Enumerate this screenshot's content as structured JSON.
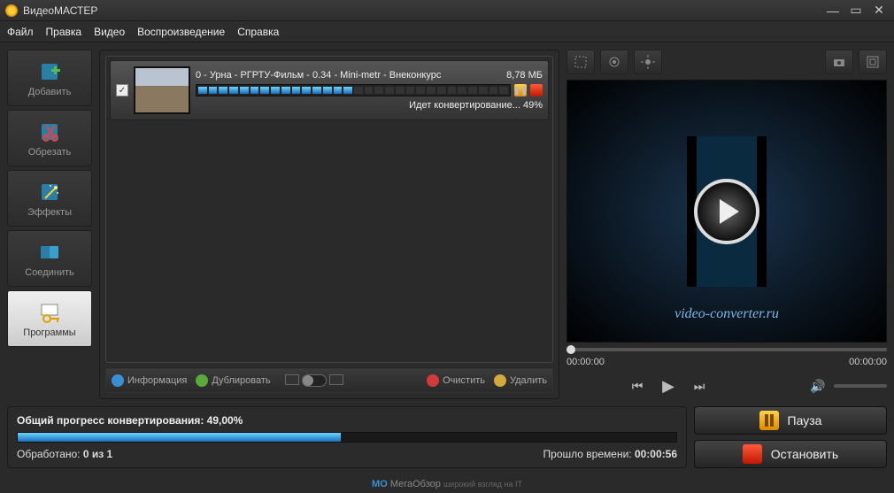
{
  "app": {
    "title": "ВидеоМАСТЕР"
  },
  "menu": {
    "file": "Файл",
    "edit": "Правка",
    "video": "Видео",
    "playback": "Воспроизведение",
    "help": "Справка"
  },
  "sidebar": {
    "add": "Добавить",
    "cut": "Обрезать",
    "effects": "Эффекты",
    "join": "Соединить",
    "programs": "Программы"
  },
  "item": {
    "name": "0 - Урна - РГРТУ-Фильм - 0.34 - Mini-metr - Внеконкурс",
    "size": "8,78 МБ",
    "status": "Идет конвертирование... 49%"
  },
  "listbar": {
    "info": "Информация",
    "dup": "Дублировать",
    "clear": "Очистить",
    "delete": "Удалить"
  },
  "player": {
    "watermark": "video-converter.ru",
    "t0": "00:00:00",
    "t1": "00:00:00"
  },
  "progress": {
    "label": "Общий прогресс конвертирования: 49,00%",
    "processed_label": "Обработано:",
    "processed_value": "0 из 1",
    "elapsed_label": "Прошло времени:",
    "elapsed_value": "00:00:56"
  },
  "buttons": {
    "pause": "Пауза",
    "stop": "Остановить"
  },
  "footer": {
    "brand_prefix": "MO",
    "brand": "МегаОбзор",
    "tagline": "широкий взгляд на IT"
  }
}
